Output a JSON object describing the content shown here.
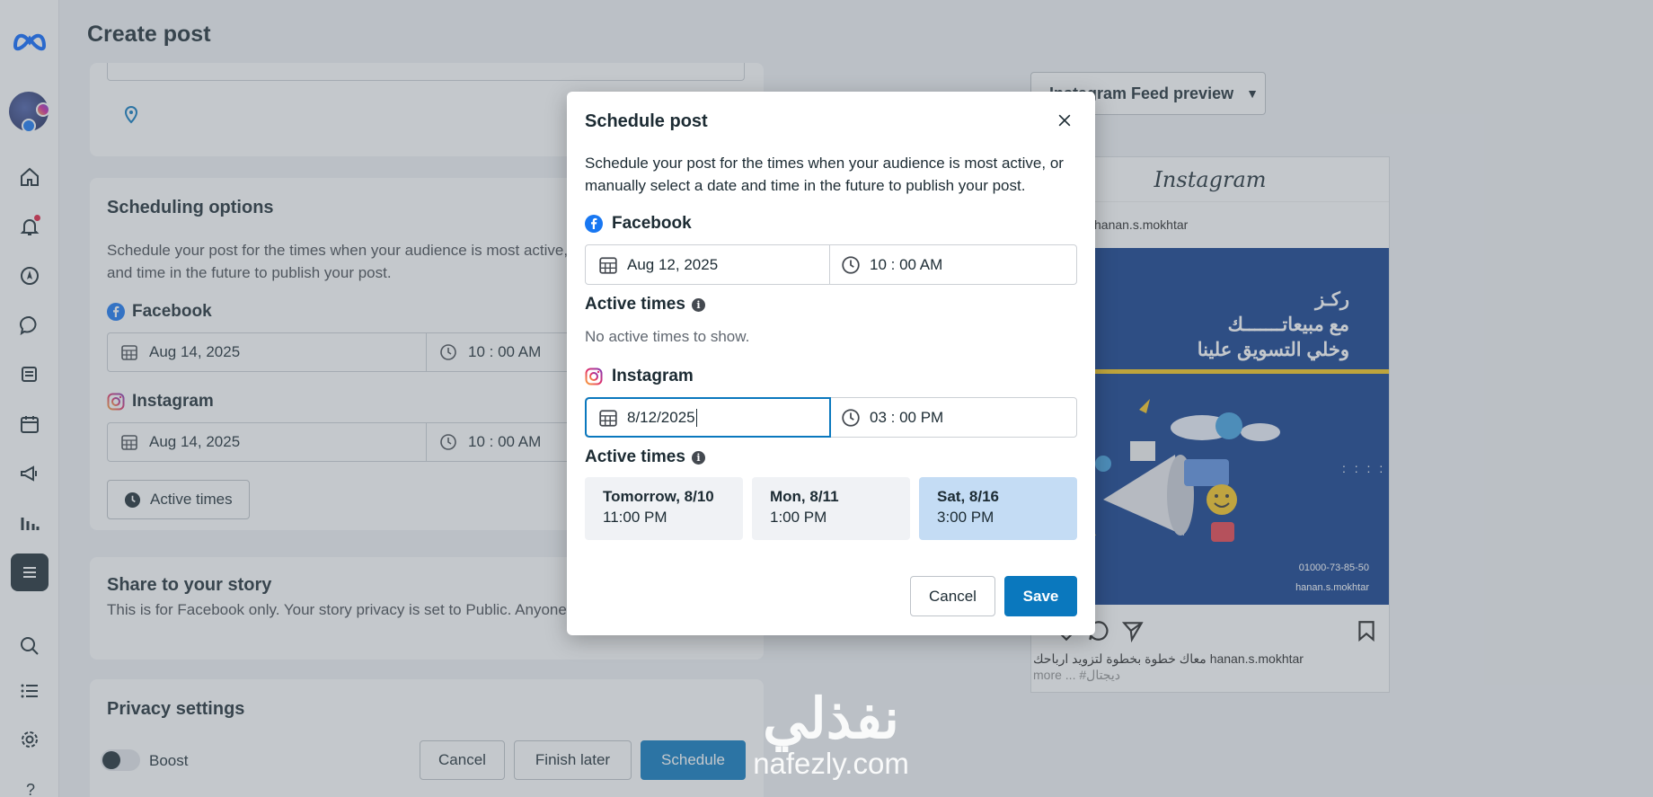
{
  "page": {
    "title": "Create post"
  },
  "scheduling": {
    "heading": "Scheduling options",
    "description": "Schedule your post for the times when your audience is most active, or manually select a date and time in the future to publish your post.",
    "facebook": {
      "label": "Facebook",
      "date": "Aug 14, 2025",
      "time": "10 : 00 AM"
    },
    "instagram": {
      "label": "Instagram",
      "date": "Aug 14, 2025",
      "time": "10 : 00 AM"
    },
    "active_times_button": "Active times"
  },
  "story": {
    "heading": "Share to your story",
    "description": "This is for Facebook only. Your story privacy is set to Public. Anyone can see your story."
  },
  "privacy": {
    "heading": "Privacy settings",
    "boost_label": "Boost",
    "cancel": "Cancel",
    "finish_later": "Finish later",
    "schedule": "Schedule"
  },
  "preview": {
    "dropdown": "Instagram Feed preview",
    "ig_logo": "Instagram",
    "username": "hanan.s.mokhtar",
    "image_lines": [
      "ركـز",
      "مع مبيعاتـــــــك",
      "وخلي التسويق علينا"
    ],
    "image_phone": "01000-73-85-50",
    "image_handle": "hanan.s.mokhtar",
    "caption_user": "hanan.s.mokhtar",
    "caption_text": "معاك خطوة بخطوة لتزويد ارباحك",
    "caption_more": "more ... #ديجتال"
  },
  "modal": {
    "title": "Schedule post",
    "description": "Schedule your post for the times when your audience is most active, or manually select a date and time in the future to publish your post.",
    "facebook": {
      "label": "Facebook",
      "date": "Aug 12, 2025",
      "time": "10 : 00 AM",
      "active_times_label": "Active times",
      "empty": "No active times to show."
    },
    "instagram": {
      "label": "Instagram",
      "date": "8/12/2025",
      "time": "03 : 00 PM",
      "active_times_label": "Active times",
      "slots": [
        {
          "day": "Tomorrow, 8/10",
          "time": "11:00 PM",
          "selected": false
        },
        {
          "day": "Mon, 8/11",
          "time": "1:00 PM",
          "selected": false
        },
        {
          "day": "Sat, 8/16",
          "time": "3:00 PM",
          "selected": true
        }
      ]
    },
    "cancel": "Cancel",
    "save": "Save"
  },
  "watermark": {
    "arabic": "نفذلي",
    "latin": "nafezly.com"
  },
  "colors": {
    "primary": "#0a78be",
    "facebook": "#1877f2",
    "selected_slot": "#c4dcf4",
    "notification": "#e41e3f"
  }
}
